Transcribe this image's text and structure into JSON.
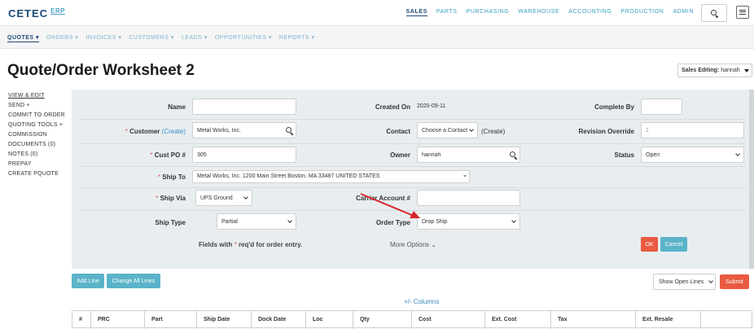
{
  "brand": {
    "name": "CETEC",
    "suffix": "ERP"
  },
  "top_nav": [
    {
      "label": "SALES",
      "active": true
    },
    {
      "label": "PARTS",
      "active": false
    },
    {
      "label": "PURCHASING",
      "active": false
    },
    {
      "label": "WAREHOUSE",
      "active": false
    },
    {
      "label": "ACCOUNTING",
      "active": false
    },
    {
      "label": "PRODUCTION",
      "active": false
    },
    {
      "label": "ADMIN",
      "active": false
    }
  ],
  "sub_nav": [
    {
      "label": "QUOTES ▾",
      "active": true
    },
    {
      "label": "ORDERS ▾",
      "active": false
    },
    {
      "label": "INVOICES ▾",
      "active": false
    },
    {
      "label": "CUSTOMERS ▾",
      "active": false
    },
    {
      "label": "LEADS ▾",
      "active": false
    },
    {
      "label": "OPPORTUNITIES ▾",
      "active": false
    },
    {
      "label": "REPORTS ▾",
      "active": false
    }
  ],
  "page_title": "Quote/Order Worksheet 2",
  "sales_editing": {
    "label": "Sales Editing:",
    "value": "hannah"
  },
  "side_menu": [
    "VIEW & EDIT",
    "SEND +",
    "COMMIT TO ORDER",
    "QUOTING TOOLS +",
    "COMMISSION",
    "DOCUMENTS (0)",
    "NOTES (0)",
    "PREPAY",
    "CREATE PQUOTE"
  ],
  "form": {
    "name": {
      "label": "Name",
      "value": ""
    },
    "created_on": {
      "label": "Created On",
      "value": "2020-09-11"
    },
    "complete_by": {
      "label": "Complete By",
      "value": ""
    },
    "customer": {
      "label": "Customer",
      "create": "(Create)",
      "value": "Metal Works, Inc."
    },
    "contact": {
      "label": "Contact",
      "value": "Choose a Contact",
      "create": "(Create)"
    },
    "revision_override": {
      "label": "Revision Override",
      "placeholder": "1"
    },
    "cust_po": {
      "label": "Cust PO #",
      "value": "305"
    },
    "owner": {
      "label": "Owner",
      "value": "hannah"
    },
    "status": {
      "label": "Status",
      "value": "Open"
    },
    "ship_to": {
      "label": "Ship To",
      "value": "Metal Works, Inc. 1200 Main Street Boston, MA 33487 UNITED STATES"
    },
    "ship_via": {
      "label": "Ship Via",
      "value": "UPS Ground"
    },
    "carrier_account": {
      "label": "Carrier Account #",
      "value": ""
    },
    "ship_type": {
      "label": "Ship Type",
      "value": "Partial"
    },
    "order_type": {
      "label": "Order Type",
      "value": "Drop Ship"
    },
    "required_note_prefix": "Fields with",
    "required_note_suffix": "req'd for order entry.",
    "required_star": "*",
    "more_options": "More Options ⌄",
    "ok_label": "OK",
    "cancel_label": "Cancel"
  },
  "actions": {
    "add_line": "Add Line",
    "change_all_lines": "Change All Lines",
    "show_open_lines": "Show Open Lines",
    "submit": "Submit",
    "columns_toggle": "+/- Columns"
  },
  "table_headers": [
    "#",
    "PRC",
    "Part",
    "Ship Date",
    "Dock Date",
    "Loc",
    "Qty",
    "Cost",
    "Ext. Cost",
    "Tax",
    "Ext. Resale"
  ],
  "colors": {
    "accent_blue": "#5bb3c9",
    "accent_red": "#e85a41",
    "brand_navy": "#1c4a78",
    "annotation_arrow": "#d9262b"
  }
}
